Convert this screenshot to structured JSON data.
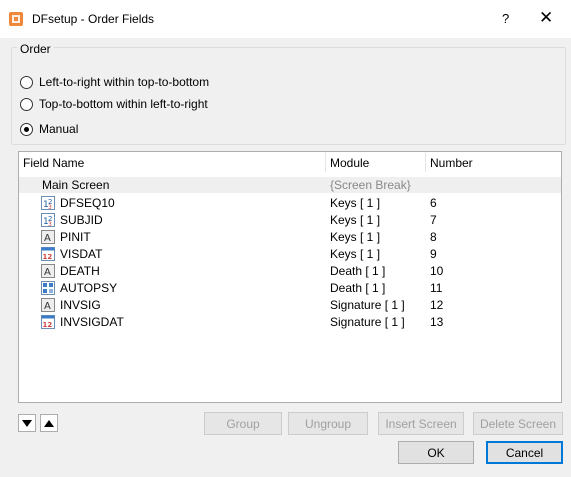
{
  "window": {
    "title": "DFsetup - Order Fields",
    "help_glyph": "?",
    "close_glyph": "✕"
  },
  "order": {
    "legend": "Order",
    "options": [
      {
        "label": "Left-to-right within top-to-bottom",
        "checked": false
      },
      {
        "label": "Top-to-bottom within left-to-right",
        "checked": false
      },
      {
        "label": "Manual",
        "checked": true
      }
    ]
  },
  "table": {
    "columns": [
      "Field Name",
      "Module",
      "Number"
    ],
    "screen_break": {
      "name": "Main Screen",
      "module": "{Screen Break}"
    },
    "rows": [
      {
        "icon": "number-field-icon",
        "name": "DFSEQ10",
        "module": "Keys [ 1 ]",
        "number": "6"
      },
      {
        "icon": "number-field-icon",
        "name": "SUBJID",
        "module": "Keys [ 1 ]",
        "number": "7"
      },
      {
        "icon": "text-field-icon",
        "name": "PINIT",
        "module": "Keys [ 1 ]",
        "number": "8"
      },
      {
        "icon": "date-field-icon",
        "name": "VISDAT",
        "module": "Keys [ 1 ]",
        "number": "9"
      },
      {
        "icon": "text-field-icon",
        "name": "DEATH",
        "module": "Death [ 1 ]",
        "number": "10"
      },
      {
        "icon": "choice-field-icon",
        "name": "AUTOPSY",
        "module": "Death [ 1 ]",
        "number": "11"
      },
      {
        "icon": "text-field-icon",
        "name": "INVSIG",
        "module": "Signature [ 1 ]",
        "number": "12"
      },
      {
        "icon": "date-field-icon",
        "name": "INVSIGDAT",
        "module": "Signature [ 1 ]",
        "number": "13"
      }
    ]
  },
  "buttons": {
    "group": "Group",
    "ungroup": "Ungroup",
    "insert_screen": "Insert Screen",
    "delete_screen": "Delete Screen",
    "ok": "OK",
    "cancel": "Cancel"
  },
  "colors": {
    "accent": "#0078d7",
    "app_icon": "#f0883c"
  }
}
